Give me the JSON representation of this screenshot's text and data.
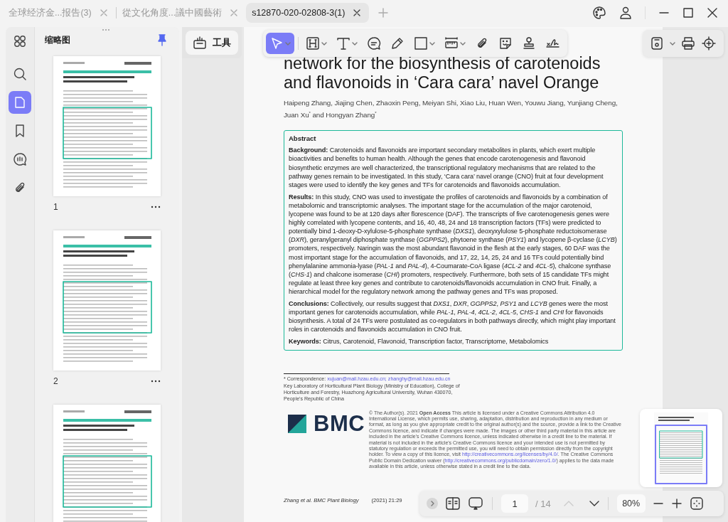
{
  "tabs": [
    {
      "label": "全球经济金...报告(3)",
      "selected": false
    },
    {
      "label": "從文化角度...議中國藝術",
      "selected": false
    },
    {
      "label": "s12870-020-02808-3(1)",
      "selected": true
    }
  ],
  "rail_items": [
    {
      "selected": false
    },
    {
      "selected": false
    },
    {
      "selected": true
    },
    {
      "selected": false
    },
    {
      "selected": false
    },
    {
      "selected": false
    }
  ],
  "thumbnail_panel": {
    "title": "缩略图",
    "pinned": true,
    "pages": [
      {
        "number": "1"
      },
      {
        "number": "2"
      }
    ],
    "partial_page": true
  },
  "tools_button": "工具",
  "toolbar": {
    "tools": [
      {
        "selected": true,
        "has_menu": true
      },
      {
        "selected": false,
        "has_menu": true
      },
      {
        "selected": false,
        "has_menu": true
      },
      {
        "selected": false,
        "has_menu": false
      },
      {
        "selected": false,
        "has_menu": false
      },
      {
        "selected": false,
        "has_menu": true
      },
      {
        "selected": false,
        "has_menu": true
      },
      {
        "selected": false,
        "has_menu": false
      },
      {
        "selected": false,
        "has_menu": false
      },
      {
        "selected": false,
        "has_menu": false
      },
      {
        "selected": false,
        "has_menu": false
      }
    ]
  },
  "doc": {
    "title_lines": [
      "network for the biosynthesis of carotenoids",
      "and flavonoids in ‘Cara cara’ navel Orange"
    ],
    "authors": "Haipeng Zhang, Jiajing Chen, Zhaoxin Peng, Meiyan Shi, Xiao Liu, Huan Wen, Youwu Jiang, Yunjiang Cheng, Juan Xu$^{*}$ and Hongyan Zhang$^{*}$",
    "abstract": {
      "heading": "Abstract",
      "sections": [
        {
          "label": "Background:",
          "text": "Carotenoids and flavonoids are important secondary metabolites in plants, which exert multiple bioactivities and benefits to human health. Although the genes that encode carotenogenesis and flavonoid biosynthetic enzymes are well characterized, the transcriptional regulatory mechanisms that are related to the pathway genes remain to be investigated. In this study, ‘Cara cara’ navel orange (CNO) fruit at four development stages were used to identify the key genes and TFs for carotenoids and flavonoids accumulation."
        },
        {
          "label": "Results:",
          "text": "In this study, CNO was used to investigate the profiles of carotenoids and flavonoids by a combination of metabolomic and transcriptomic analyses. The important stage for the accumulation of the major carotenoid, lycopene was found to be at 120 days after florescence (DAF). The transcripts of five carotenogenesis genes were highly correlated with lycopene contents, and 16, 40, 48, 24 and 18 transcription factors (TFs) were predicted to potentially bind 1-deoxy-D-xylulose-5-phosphate synthase (*DXS1*), deoxyxylulose 5-phosphate reductoisomerase (*DXR*), geranylgeranyl diphosphate synthase (*GGPPS2*), phytoene synthase (*PSY1*) and lycopene β-cyclase (*LCYB*) promoters, respectively. Naringin was the most abundant flavonoid in the flesh at the early stages, 60 DAF was the most important stage for the accumulation of flavonoids, and 17, 22, 14, 25, 24 and 16 TFs could potentially bind phenylalanine ammonia-lyase (*PAL-1* and *PAL-4*), 4-Coumarate-CoA ligase (*4CL-2* and *4CL-5*), chalcone synthase (*CHS-1*) and chalcone isomerase (*CHI*) promoters, respectively. Furthermore, both sets of 15 candidate TFs might regulate at least three key genes and contribute to carotenoids/flavonoids accumulation in CNO fruit. Finally, a hierarchical model for the regulatory network among the pathway genes and TFs was proposed."
        },
        {
          "label": "Conclusions:",
          "text": "Collectively, our results suggest that *DXS1*, *DXR*, *GGPPS2*, *PSY1* and *LCYB* genes were the most important genes for carotenoids accumulation, while *PAL-1*, *PAL-4*, *4CL-2*, *4CL-5*, *CHS-1* and *CHI* for flavonoids biosynthesis. A total of 24 TFs were postulated as co-regulators in both pathways directly, which might play important roles in carotenoids and flavonoids accumulation in CNO fruit."
        },
        {
          "label": "Keywords:",
          "text": "Citrus, Carotenoid, Flavonoid, Transcription factor, Transcriptome, Metabolomics"
        }
      ]
    },
    "correspondence": {
      "label": "* Correspondence:",
      "emails": [
        "xujuan@mail.hzau.edu.cn;",
        "zhanghy@mail.hzau.edu.cn"
      ]
    },
    "affiliation": "Key Laboratory of Horticultural Plant Biology (Ministry of Education), College of Horticulture and Forestry, Huazhong Agricultural University, Wuhan 430070, People's Republic of China",
    "logo_text": "BMC",
    "license": [
      {
        "kind": "text",
        "text": "© The Author(s). 2021 **Open Access** This article is licensed under a Creative Commons Attribution 4.0 International License, which permits use, sharing, adaptation, distribution and reproduction in any medium or format, as long as you give appropriate credit to the original author(s) and the source, provide a link to the Creative Commons licence, and indicate if changes were made. The images or other third party material in this article are included in the article's Creative Commons licence, unless indicated otherwise in a credit line to the material. If material is not included in the article's Creative Commons licence and your intended use is not permitted by statutory regulation or exceeds the permitted use, you will need to obtain permission directly from the copyright holder. To view a copy of this licence, visit "
      },
      {
        "kind": "link",
        "text": "http://creativecommons.org/licenses/by/4.0/"
      },
      {
        "kind": "text",
        "text": ". The Creative Commons Public Domain Dedication waiver ("
      },
      {
        "kind": "link",
        "text": "http://creativecommons.org/publicdomain/zero/1.0/"
      },
      {
        "kind": "text",
        "text": ") applies to the data made available in this article, unless otherwise stated in a credit line to the data."
      }
    ],
    "footer": {
      "journal": "Zhang et al. BMC Plant Biology",
      "citation": "(2021) 21:29"
    }
  },
  "nav": {
    "page": "1",
    "total": "/ 14",
    "prev_disabled": true,
    "zoom": "80%"
  }
}
